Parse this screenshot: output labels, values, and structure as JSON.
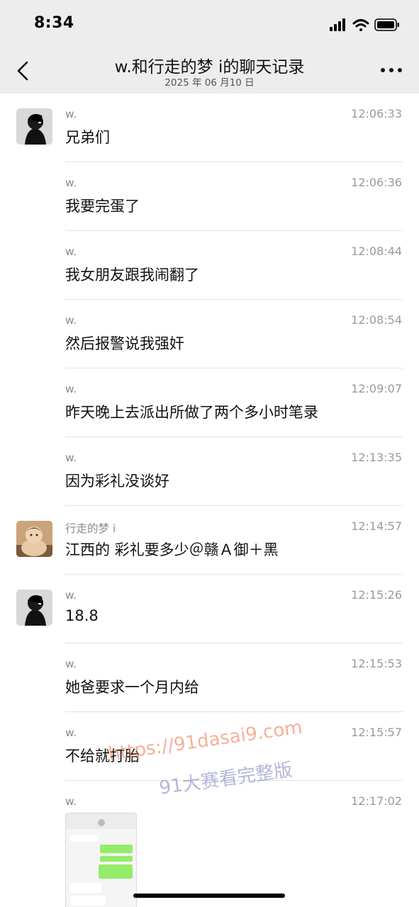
{
  "status_bar": {
    "time": "8:34"
  },
  "nav": {
    "title": "w.和行走的梦 i的聊天记录",
    "subtitle": "2025 年 06 月10 日"
  },
  "messages": [
    {
      "sender": "w.",
      "time": "12:06:33",
      "text": "兄弟们"
    },
    {
      "sender": "w.",
      "time": "12:06:36",
      "text": "我要完蛋了"
    },
    {
      "sender": "w.",
      "time": "12:08:44",
      "text": "我女朋友跟我闹翻了"
    },
    {
      "sender": "w.",
      "time": "12:08:54",
      "text": "然后报警说我强奸"
    },
    {
      "sender": "w.",
      "time": "12:09:07",
      "text": "昨天晚上去派出所做了两个多小时笔录"
    },
    {
      "sender": "w.",
      "time": "12:13:35",
      "text": "因为彩礼没谈好"
    },
    {
      "sender": "行走的梦 i",
      "time": "12:14:57",
      "text": "江西的 彩礼要多少＠赣Ａ御＋黑"
    },
    {
      "sender": "w.",
      "time": "12:15:26",
      "text": "18.8"
    },
    {
      "sender": "w.",
      "time": "12:15:53",
      "text": "她爸要求一个月内给"
    },
    {
      "sender": "w.",
      "time": "12:15:57",
      "text": "不给就打胎"
    },
    {
      "sender": "w.",
      "time": "12:17:02",
      "text": ""
    }
  ],
  "watermark": {
    "url": "https://91dasai9.com",
    "site": "91大赛看完整版"
  },
  "icons": {
    "back": "chevron-left-icon",
    "more": "more-dots-icon",
    "signal": "signal-icon",
    "wifi": "wifi-icon",
    "battery": "battery-icon"
  },
  "colors": {
    "header_bg": "#ededed",
    "thumb_bubble_green": "#95ec69"
  }
}
